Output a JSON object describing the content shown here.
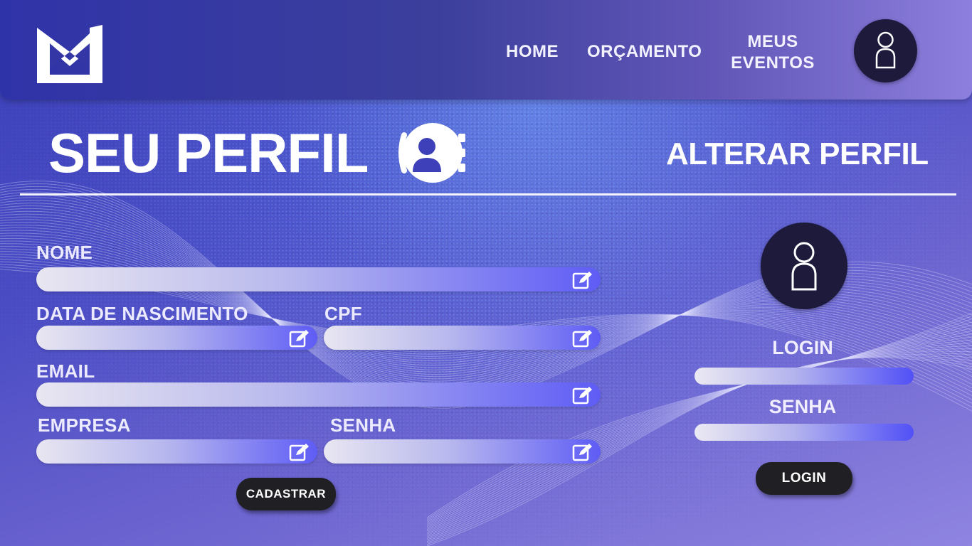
{
  "header": {
    "nav": [
      {
        "label": "HOME"
      },
      {
        "label": "ORÇAMENTO"
      },
      {
        "label": "MEUS EVENTOS",
        "line1": "MEUS",
        "line2": "EVENTOS"
      }
    ]
  },
  "main": {
    "title": "SEU PERFIL",
    "alter_title": "ALTERAR PERFIL"
  },
  "form": {
    "nome": {
      "label": "NOME",
      "value": "",
      "placeholder": ""
    },
    "nascimento": {
      "label": "DATA DE NASCIMENTO",
      "value": "",
      "placeholder": ""
    },
    "cpf": {
      "label": "CPF",
      "value": "",
      "placeholder": ""
    },
    "email": {
      "label": "EMAIL",
      "value": "",
      "placeholder": ""
    },
    "empresa": {
      "label": "EMPRESA",
      "value": "",
      "placeholder": ""
    },
    "senha": {
      "label": "SENHA",
      "value": "",
      "placeholder": ""
    },
    "submit_label": "CADASTRAR"
  },
  "login": {
    "login_label": "LOGIN",
    "senha_label": "SENHA",
    "button_label": "LOGIN"
  },
  "icons": {
    "logo": "logo-icon",
    "user": "user-icon",
    "profile_settings": "profile-settings-icon",
    "edit": "edit-icon"
  },
  "colors": {
    "header_start": "#2f33a8",
    "header_end": "#8c7fdd",
    "field_end": "#5e5cf5",
    "button": "#1f1f24",
    "avatar": "#1d1a3c"
  }
}
